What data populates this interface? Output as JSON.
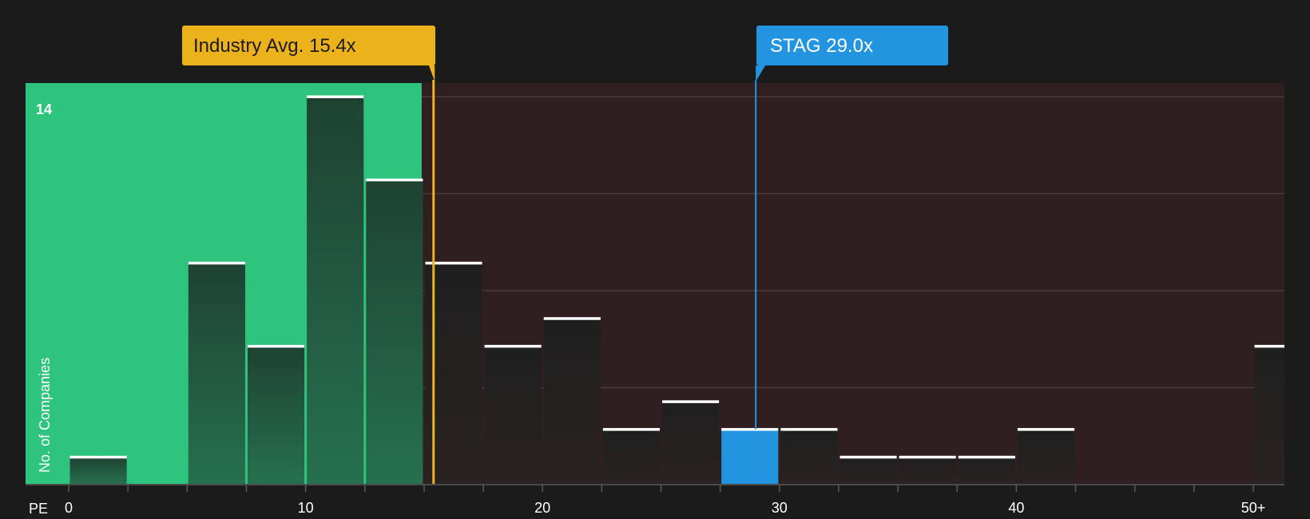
{
  "chart_data": {
    "type": "bar",
    "xlabel": "PE",
    "ylabel": "No. of Companies",
    "x_ticks": [
      {
        "value": 0,
        "label": "0"
      },
      {
        "value": 10,
        "label": "10"
      },
      {
        "value": 20,
        "label": "20"
      },
      {
        "value": 30,
        "label": "30"
      },
      {
        "value": 40,
        "label": "40"
      },
      {
        "value": 50,
        "label": "50+"
      }
    ],
    "y_ticks": [
      {
        "value": 14,
        "label": "14"
      }
    ],
    "ylim": [
      0,
      14
    ],
    "grid_y_values": [
      3.5,
      7,
      10.5,
      14
    ],
    "bin_width": 2.5,
    "bars": [
      {
        "x0": 0,
        "value": 1
      },
      {
        "x0": 5,
        "value": 8
      },
      {
        "x0": 7.5,
        "value": 5
      },
      {
        "x0": 10,
        "value": 14
      },
      {
        "x0": 12.5,
        "value": 11
      },
      {
        "x0": 15,
        "value": 8
      },
      {
        "x0": 17.5,
        "value": 5
      },
      {
        "x0": 20,
        "value": 6
      },
      {
        "x0": 22.5,
        "value": 2
      },
      {
        "x0": 25,
        "value": 3
      },
      {
        "x0": 27.5,
        "value": 2,
        "highlight": true
      },
      {
        "x0": 30,
        "value": 2
      },
      {
        "x0": 32.5,
        "value": 1
      },
      {
        "x0": 35,
        "value": 1
      },
      {
        "x0": 37.5,
        "value": 1
      },
      {
        "x0": 40,
        "value": 2
      },
      {
        "x0": 50,
        "value": 5
      }
    ],
    "industry_avg": {
      "label": "Industry Avg. 15.4x",
      "value": 15.4
    },
    "company": {
      "label": "STAG 29.0x",
      "value": 29.0
    },
    "green_zone_end": 14.9
  },
  "colors": {
    "background": "#1b1b1b",
    "green_zone": "#2ec47e",
    "red_zone": "#2f1f20",
    "bar_in_green": "#1f4a36",
    "bar_in_red": "#241f1f",
    "highlight": "#2394e0",
    "industry": "#ecb21c",
    "gridline": "#4a3a3b"
  }
}
